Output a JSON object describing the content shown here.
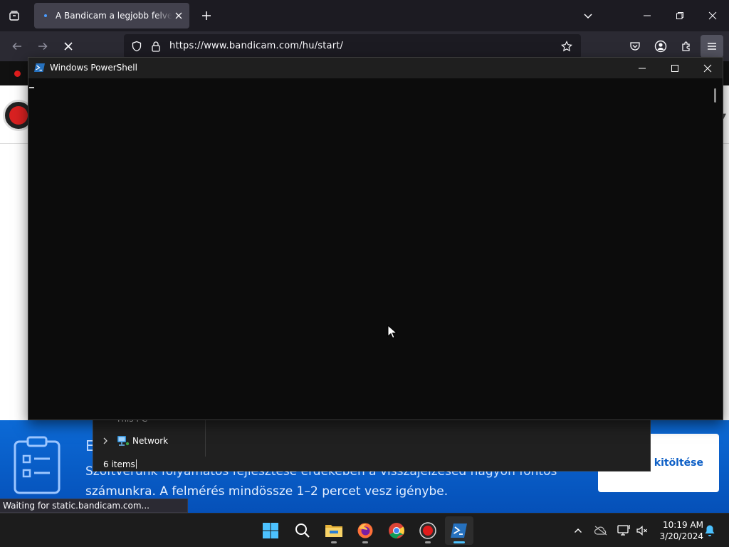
{
  "browser": {
    "tab": {
      "title": "A Bandicam a legjobb felvevőprogram"
    },
    "url": "https://www.bandicam.com/hu/start/",
    "status_text": "Waiting for static.bandicam.com..."
  },
  "page": {
    "survey": {
      "title_fragment": "E",
      "line1": "Szoftverünk folyamatos fejlesztése érdekében a visszajelzésed nagyon fontos",
      "line2": "számunkra. A felmérés mindössze 1–2 percet vesz igénybe.",
      "button_label": "es kitöltése"
    }
  },
  "explorer": {
    "tree_partial": "This PC",
    "network_label": "Network",
    "status": "6 items"
  },
  "powershell": {
    "title": "Windows PowerShell"
  },
  "taskbar": {
    "time": "10:19 AM",
    "date": "3/20/2024"
  },
  "colors": {
    "browser_bg": "#1c1b22",
    "navbar_bg": "#2b2a33",
    "survey_blue": "#0c6ad6",
    "powershell_bg": "#0c0c0c",
    "accent": "#4cc2ff"
  }
}
